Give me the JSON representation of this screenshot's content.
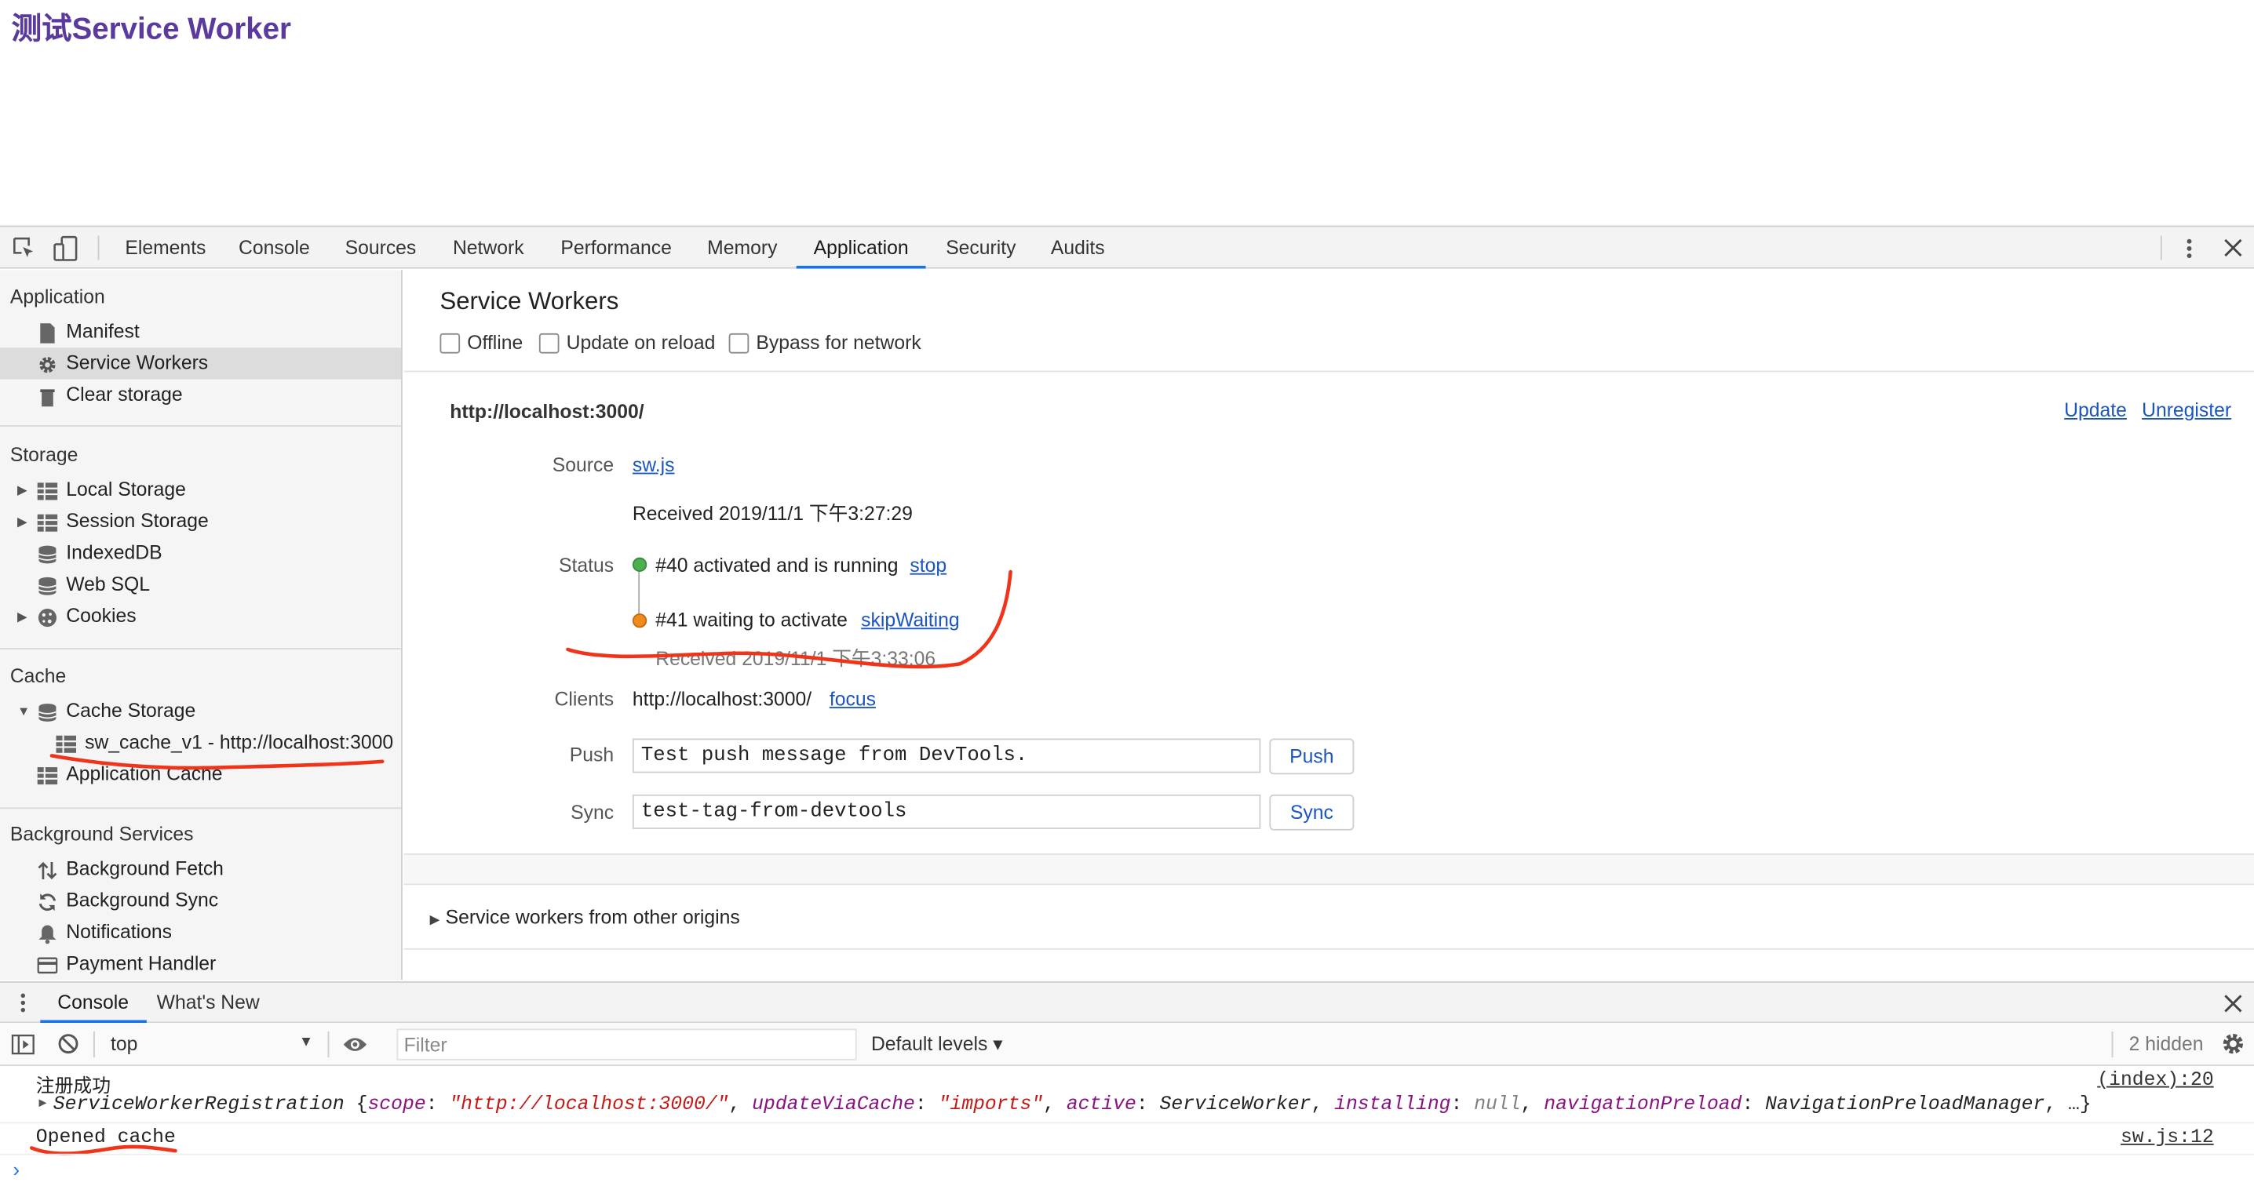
{
  "page": {
    "title": "测试Service Worker"
  },
  "devtools": {
    "tabs": [
      "Elements",
      "Console",
      "Sources",
      "Network",
      "Performance",
      "Memory",
      "Application",
      "Security",
      "Audits"
    ],
    "active_tab": "Application"
  },
  "sidebar": {
    "application": {
      "heading": "Application",
      "items": [
        "Manifest",
        "Service Workers",
        "Clear storage"
      ]
    },
    "storage": {
      "heading": "Storage",
      "items": [
        "Local Storage",
        "Session Storage",
        "IndexedDB",
        "Web SQL",
        "Cookies"
      ]
    },
    "cache": {
      "heading": "Cache",
      "items": [
        "Cache Storage",
        "sw_cache_v1 - http://localhost:3000",
        "Application Cache"
      ]
    },
    "background": {
      "heading": "Background Services",
      "items": [
        "Background Fetch",
        "Background Sync",
        "Notifications",
        "Payment Handler"
      ]
    }
  },
  "sw": {
    "title": "Service Workers",
    "options": [
      "Offline",
      "Update on reload",
      "Bypass for network"
    ],
    "origin": "http://localhost:3000/",
    "update_link": "Update",
    "unregister_link": "Unregister",
    "source_label": "Source",
    "source_file": "sw.js",
    "received": "Received 2019/11/1 下午3:27:29",
    "status_label": "Status",
    "status1_text": "#40 activated and is running",
    "status1_action": "stop",
    "status2_text": "#41 waiting to activate",
    "status2_action": "skipWaiting",
    "status2_received": "Received 2019/11/1 下午3:33:06",
    "clients_label": "Clients",
    "clients_value": "http://localhost:3000/",
    "clients_action": "focus",
    "push_label": "Push",
    "push_value": "Test push message from DevTools.",
    "push_button": "Push",
    "sync_label": "Sync",
    "sync_value": "test-tag-from-devtools",
    "sync_button": "Sync",
    "other_origins": "Service workers from other origins"
  },
  "drawer": {
    "tabs": [
      "Console",
      "What's New"
    ],
    "context": "top",
    "filter_placeholder": "Filter",
    "levels": "Default levels ▾",
    "hidden": "2 hidden"
  },
  "console": {
    "line1": "注册成功",
    "line1_src": "(index):20",
    "obj_name": "ServiceWorkerRegistration",
    "obj_open": "{",
    "k_scope": "scope",
    "v_scope": "\"http://localhost:3000/\"",
    "k_update": "updateViaCache",
    "v_update": "\"imports\"",
    "k_active": "active",
    "v_active": "ServiceWorker",
    "k_installing": "installing",
    "v_installing": "null",
    "k_preload": "navigationPreload",
    "v_preload": "NavigationPreloadManager",
    "obj_tail": "…}",
    "line3": "Opened cache",
    "line3_src": "sw.js:12",
    "prompt": "›"
  },
  "colors": {
    "accent": "#1a73e8",
    "link": "#1a55c4",
    "title": "#5b3a9e",
    "annotation": "#f0341a",
    "status_running": "#4caf50",
    "status_waiting": "#f08a1c"
  }
}
